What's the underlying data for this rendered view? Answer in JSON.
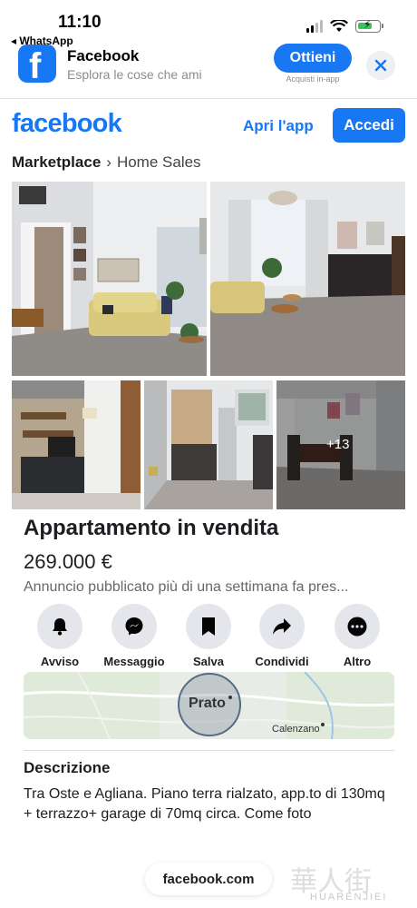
{
  "status_bar": {
    "time": "11:10",
    "back_app": "◂ WhatsApp"
  },
  "app_banner": {
    "app_name": "Facebook",
    "tagline": "Esplora le cose che ami",
    "get_label": "Ottieni",
    "inapp_note": "Acquisti in-app"
  },
  "header": {
    "logo": "facebook",
    "open_app": "Apri l'app",
    "login": "Accedi"
  },
  "breadcrumb": {
    "section": "Marketplace",
    "separator": "›",
    "category": "Home Sales"
  },
  "gallery": {
    "more_count": "+13"
  },
  "listing": {
    "title": "Appartamento in vendita",
    "price": "269.000 €",
    "posted": "Annuncio pubblicato più di una settimana fa pres..."
  },
  "actions": [
    {
      "label": "Avviso",
      "icon": "bell-icon"
    },
    {
      "label": "Messaggio",
      "icon": "messenger-icon"
    },
    {
      "label": "Salva",
      "icon": "bookmark-icon"
    },
    {
      "label": "Condividi",
      "icon": "share-icon"
    },
    {
      "label": "Altro",
      "icon": "more-icon"
    }
  ],
  "map": {
    "main_label": "Prato",
    "secondary_label": "Calenzano"
  },
  "description": {
    "heading": "Descrizione",
    "text": "Tra Oste e Agliana. Piano terra rialzato, app.to di 130mq + terrazzo+ garage di 70mq circa. Come foto"
  },
  "footer": {
    "url": "facebook.com"
  },
  "watermark": {
    "text": "HUARENJIEI"
  },
  "colors": {
    "brand": "#1877f2",
    "muted": "#65676b",
    "action_bg": "#e4e6eb"
  }
}
